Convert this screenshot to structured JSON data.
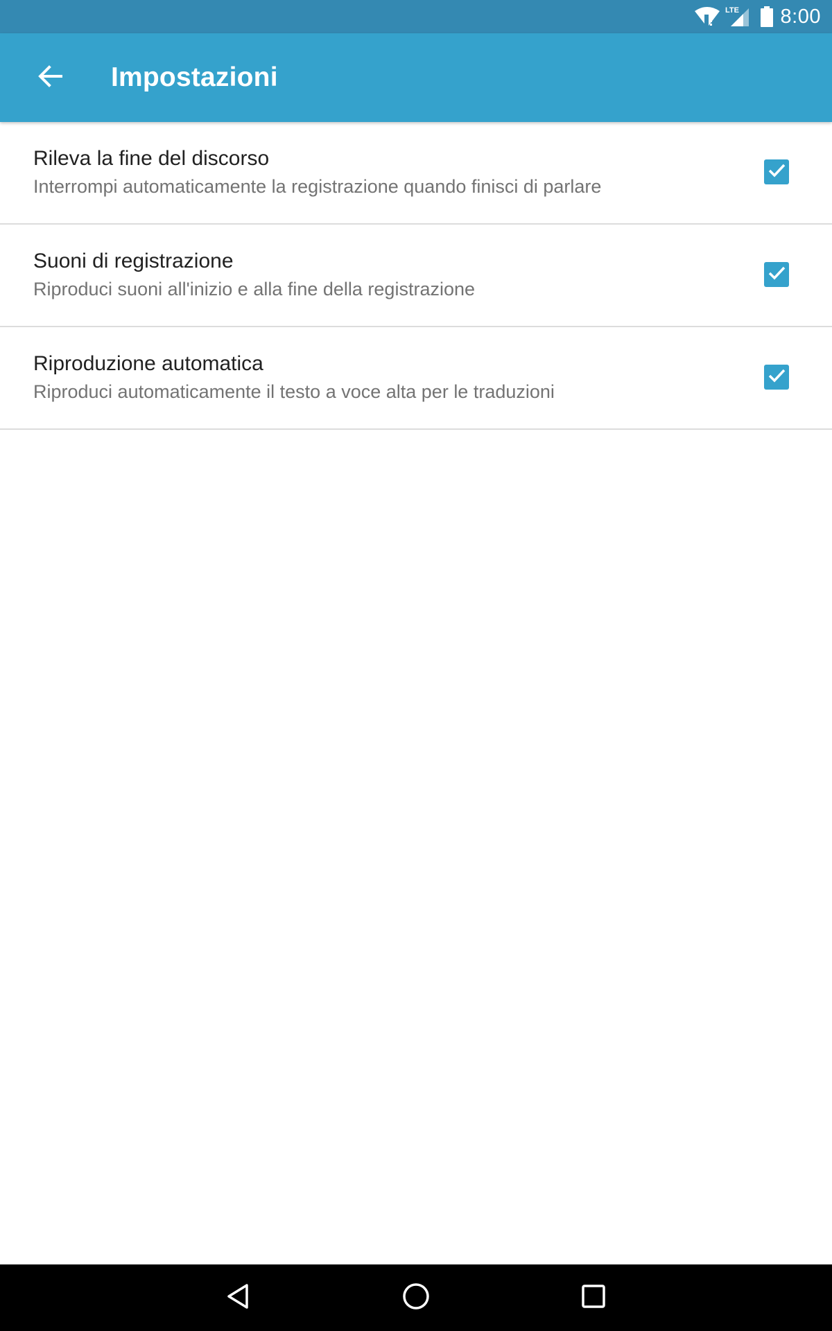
{
  "status_bar": {
    "time": "8:00",
    "network": "LTE",
    "icons": [
      "wifi-icon",
      "cellular-signal-icon",
      "battery-icon"
    ]
  },
  "app_bar": {
    "title": "Impostazioni",
    "back_icon": "arrow-back-icon"
  },
  "settings": [
    {
      "title": "Rileva la fine del discorso",
      "summary": "Interrompi automaticamente la registrazione quando finisci di parlare",
      "checked": true
    },
    {
      "title": "Suoni di registrazione",
      "summary": "Riproduci suoni all'inizio e alla fine della registrazione",
      "checked": true
    },
    {
      "title": "Riproduzione automatica",
      "summary": "Riproduci automaticamente il testo a voce alta per le traduzioni",
      "checked": true
    }
  ],
  "nav_bar": {
    "icons": [
      "nav-back-icon",
      "nav-home-icon",
      "nav-recents-icon"
    ]
  },
  "colors": {
    "status_bar": "#3489b2",
    "app_bar": "#35a2cc",
    "accent": "#35a2cc",
    "nav_bar": "#000000"
  }
}
